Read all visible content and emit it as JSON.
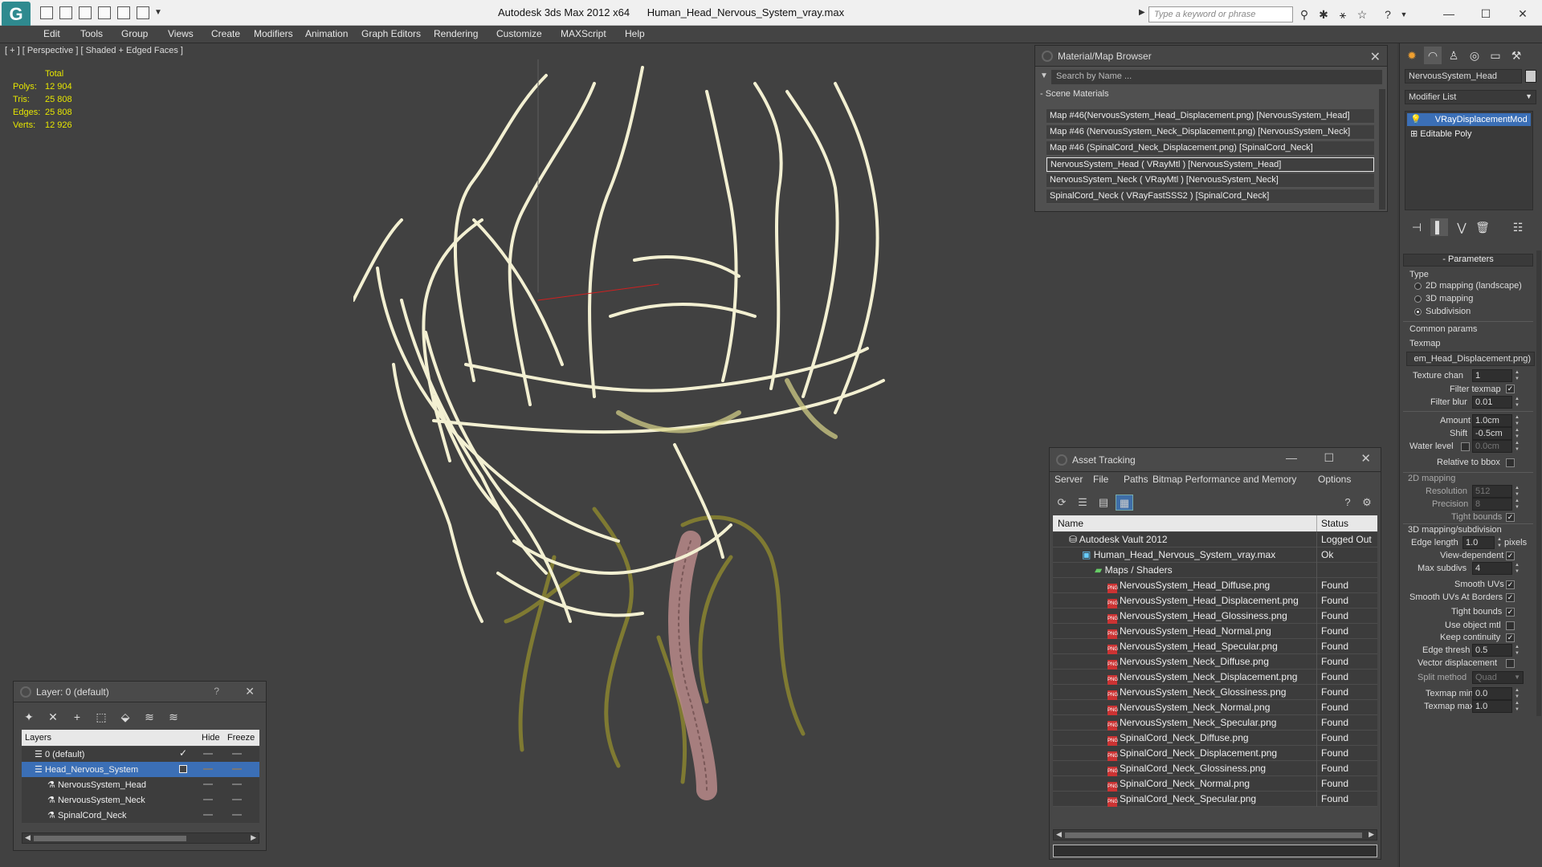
{
  "titlebar": {
    "app_title": "Autodesk 3ds Max  2012 x64",
    "file_name": "Human_Head_Nervous_System_vray.max",
    "search_placeholder": "Type a keyword or phrase"
  },
  "menu": [
    "Edit",
    "Tools",
    "Group",
    "Views",
    "Create",
    "Modifiers",
    "Animation",
    "Graph Editors",
    "Rendering",
    "Customize",
    "MAXScript",
    "Help"
  ],
  "viewport": {
    "label": "[ + ] [ Perspective ] [ Shaded + Edged Faces ]",
    "stats": {
      "header": "Total",
      "rows": [
        {
          "label": "Polys:",
          "value": "12 904"
        },
        {
          "label": "Tris:",
          "value": "25 808"
        },
        {
          "label": "Edges:",
          "value": "25 808"
        },
        {
          "label": "Verts:",
          "value": "12 926"
        }
      ]
    }
  },
  "material_browser": {
    "title": "Material/Map Browser",
    "search_placeholder": "Search by Name ...",
    "section": "Scene Materials",
    "items": [
      "Map #46(NervousSystem_Head_Displacement.png) [NervousSystem_Head]",
      "Map #46 (NervousSystem_Neck_Displacement.png) [NervousSystem_Neck]",
      "Map #46 (SpinalCord_Neck_Displacement.png) [SpinalCord_Neck]",
      "NervousSystem_Head  ( VRayMtl )  [NervousSystem_Head]",
      "NervousSystem_Neck  ( VRayMtl )  [NervousSystem_Neck]",
      "SpinalCord_Neck  ( VRayFastSSS2 )  [SpinalCord_Neck]"
    ]
  },
  "asset_tracking": {
    "title": "Asset Tracking",
    "menu": [
      "Server",
      "File",
      "Paths",
      "Bitmap Performance and Memory",
      "Options"
    ],
    "columns": {
      "name": "Name",
      "status": "Status"
    },
    "vault": {
      "name": "Autodesk Vault 2012",
      "status": "Logged Out"
    },
    "file": {
      "name": "Human_Head_Nervous_System_vray.max",
      "status": "Ok"
    },
    "folder": "Maps / Shaders",
    "maps": [
      {
        "name": "NervousSystem_Head_Diffuse.png",
        "status": "Found"
      },
      {
        "name": "NervousSystem_Head_Displacement.png",
        "status": "Found"
      },
      {
        "name": "NervousSystem_Head_Glossiness.png",
        "status": "Found"
      },
      {
        "name": "NervousSystem_Head_Normal.png",
        "status": "Found"
      },
      {
        "name": "NervousSystem_Head_Specular.png",
        "status": "Found"
      },
      {
        "name": "NervousSystem_Neck_Diffuse.png",
        "status": "Found"
      },
      {
        "name": "NervousSystem_Neck_Displacement.png",
        "status": "Found"
      },
      {
        "name": "NervousSystem_Neck_Glossiness.png",
        "status": "Found"
      },
      {
        "name": "NervousSystem_Neck_Normal.png",
        "status": "Found"
      },
      {
        "name": "NervousSystem_Neck_Specular.png",
        "status": "Found"
      },
      {
        "name": "SpinalCord_Neck_Diffuse.png",
        "status": "Found"
      },
      {
        "name": "SpinalCord_Neck_Displacement.png",
        "status": "Found"
      },
      {
        "name": "SpinalCord_Neck_Glossiness.png",
        "status": "Found"
      },
      {
        "name": "SpinalCord_Neck_Normal.png",
        "status": "Found"
      },
      {
        "name": "SpinalCord_Neck_Specular.png",
        "status": "Found"
      }
    ],
    "png_badge": "PNG"
  },
  "layers": {
    "title": "Layer: 0 (default)",
    "help": "?",
    "columns": {
      "layers": "Layers",
      "hide": "Hide",
      "freeze": "Freeze"
    },
    "rows": [
      {
        "name": "0 (default)"
      },
      {
        "name": "Head_Nervous_System"
      },
      {
        "name": "NervousSystem_Head"
      },
      {
        "name": "NervousSystem_Neck"
      },
      {
        "name": "SpinalCord_Neck"
      }
    ]
  },
  "command_panel": {
    "object_name": "NervousSystem_Head",
    "modifier_list": "Modifier List",
    "stack": [
      "VRayDisplacementMod",
      "Editable Poly"
    ],
    "rollout": "Parameters",
    "type_label": "Type",
    "type_options": [
      "2D mapping (landscape)",
      "3D mapping",
      "Subdivision"
    ],
    "common_params": "Common params",
    "texmap_label": "Texmap",
    "texmap_value": "em_Head_Displacement.png)",
    "texture_chan": {
      "label": "Texture chan",
      "value": "1"
    },
    "filter_texmap": "Filter texmap",
    "filter_blur": {
      "label": "Filter blur",
      "value": "0.01"
    },
    "amount": {
      "label": "Amount",
      "value": "1.0cm"
    },
    "shift": {
      "label": "Shift",
      "value": "-0.5cm"
    },
    "water_level": {
      "label": "Water level",
      "value": "0.0cm"
    },
    "relative_bbox": "Relative to bbox",
    "mapping2d": "2D mapping",
    "resolution": {
      "label": "Resolution",
      "value": "512"
    },
    "precision": {
      "label": "Precision",
      "value": "8"
    },
    "tight_bounds_2d": "Tight bounds",
    "mapping3d": "3D mapping/subdivision",
    "edge_length": {
      "label": "Edge length",
      "value": "1.0",
      "unit": "pixels"
    },
    "view_dependent": "View-dependent",
    "max_subdivs": {
      "label": "Max subdivs",
      "value": "4"
    },
    "smooth_uvs": "Smooth UVs",
    "smooth_uvs_borders": "Smooth UVs At Borders",
    "tight_bounds": "Tight bounds",
    "use_object_mtl": "Use object mtl",
    "keep_continuity": "Keep continuity",
    "edge_thresh": {
      "label": "Edge thresh",
      "value": "0.5"
    },
    "vector_disp": "Vector displacement",
    "split_method": {
      "label": "Split method",
      "value": "Quad"
    },
    "texmap_min": {
      "label": "Texmap min:",
      "value": "0.0"
    },
    "texmap_max": {
      "label": "Texmap max:",
      "value": "1.0"
    },
    "check": "✓"
  }
}
